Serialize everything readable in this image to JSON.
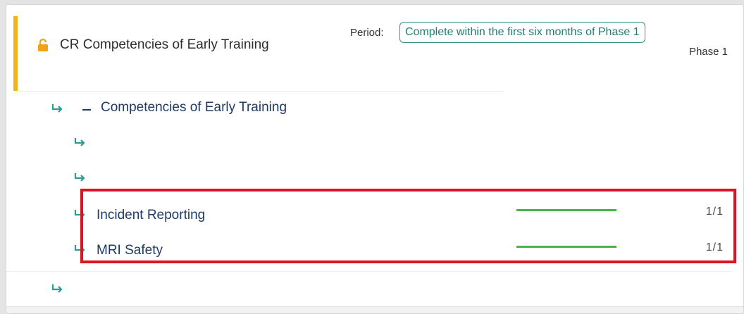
{
  "header": {
    "title": "CR Competencies of Early Training",
    "lock_icon": "lock-open-icon",
    "period_label": "Period:",
    "period_value": "Complete within the first six months of Phase 1",
    "phase": "Phase 1"
  },
  "group": {
    "title": "Competencies of Early Training",
    "toggle_icon": "collapse-minus-icon"
  },
  "rows": [
    {
      "label": ""
    },
    {
      "label": ""
    },
    {
      "label": "Incident Reporting",
      "progress": 1.0,
      "count": "1/1"
    },
    {
      "label": "MRI Safety",
      "progress": 1.0,
      "count": "1/1"
    },
    {
      "label": ""
    }
  ],
  "colors": {
    "accent": "#f3b31b",
    "link": "#1f3a63",
    "teal": "#1e7d73",
    "arrow": "#2a9d8f",
    "progress": "#4caf50",
    "highlight": "#e0121f"
  }
}
